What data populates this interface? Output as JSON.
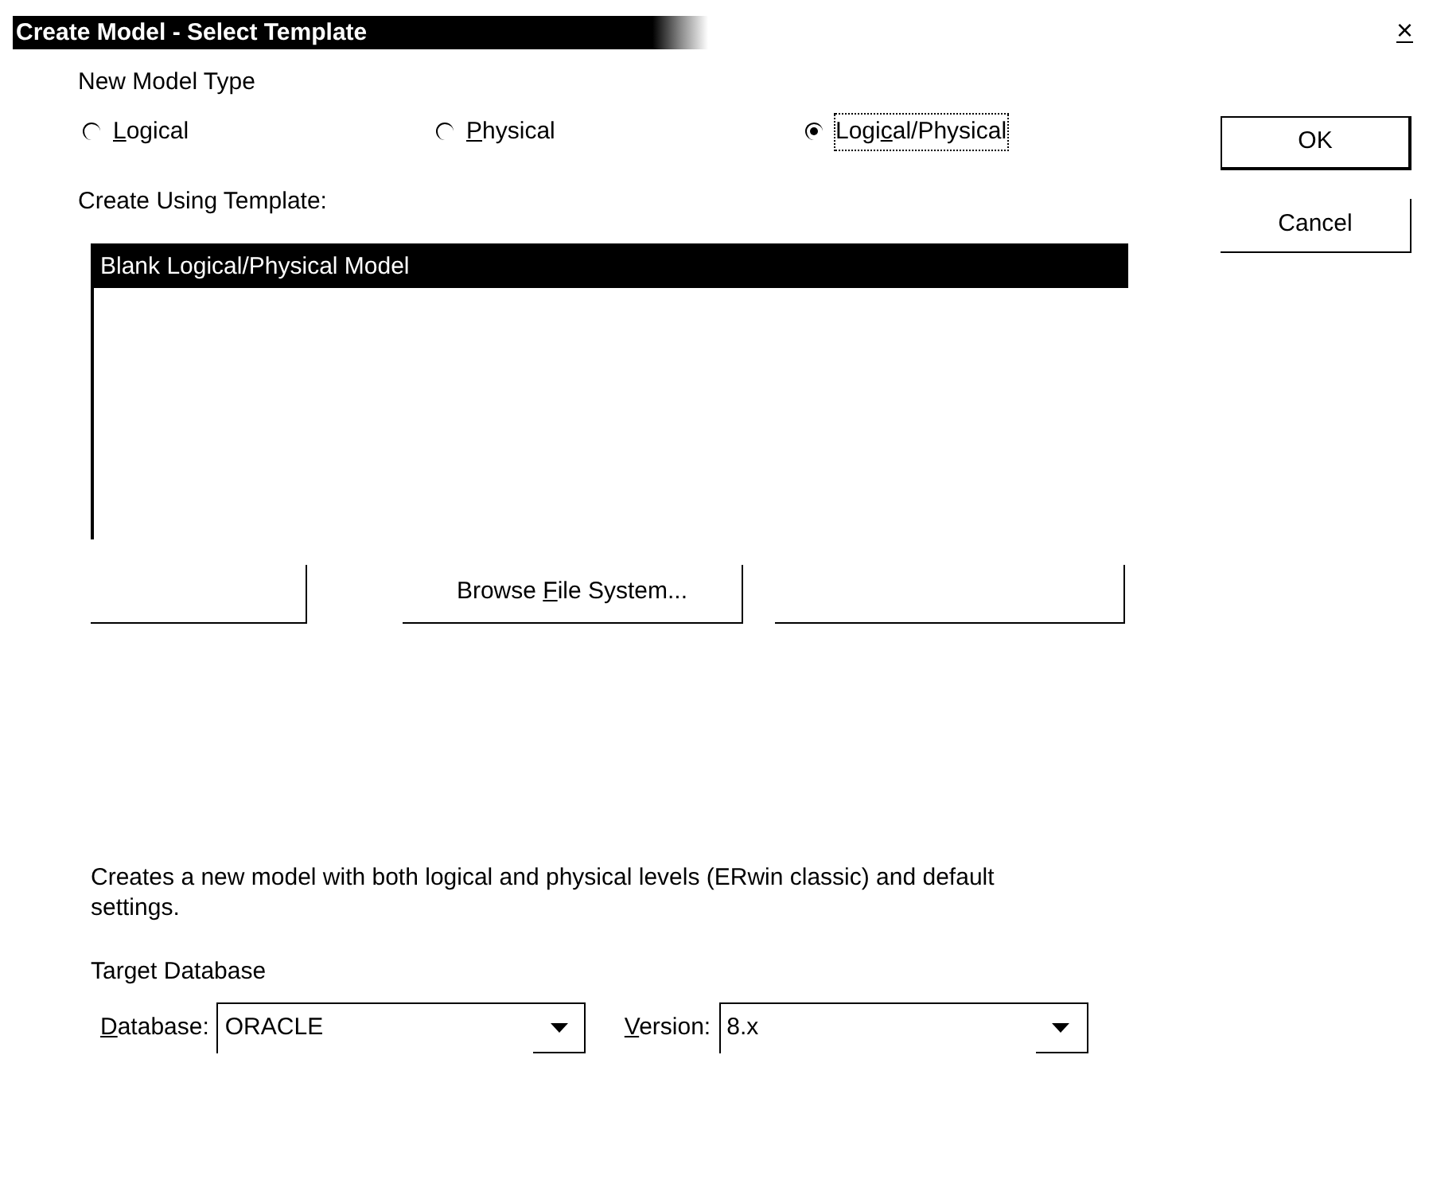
{
  "window": {
    "title": "Create Model - Select Template",
    "close": "×"
  },
  "model_type": {
    "label": "New Model Type",
    "options": [
      {
        "key": "L",
        "after": "ogical",
        "selected": false
      },
      {
        "key": "P",
        "after": "hysical",
        "selected": false
      },
      {
        "before": "Logi",
        "key": "c",
        "after": "al/Physical",
        "selected": true
      }
    ]
  },
  "template": {
    "label": "Create Using Template:",
    "items": [
      {
        "text": "Blank Logical/Physical Model",
        "selected": true
      }
    ],
    "buttons": [
      {
        "kind": "blank"
      },
      {
        "kind": "labeled",
        "before": "Browse ",
        "key": "F",
        "after": "ile System..."
      },
      {
        "kind": "blank"
      }
    ]
  },
  "description": "Creates a new model with both logical and physical levels (ERwin classic) and default settings.",
  "target": {
    "label": "Target Database",
    "fields": [
      {
        "key": "D",
        "after": "atabase:",
        "value": "ORACLE"
      },
      {
        "key": "V",
        "after": "ersion:",
        "value": "8.x"
      }
    ]
  },
  "buttons": [
    "OK",
    "Cancel"
  ]
}
